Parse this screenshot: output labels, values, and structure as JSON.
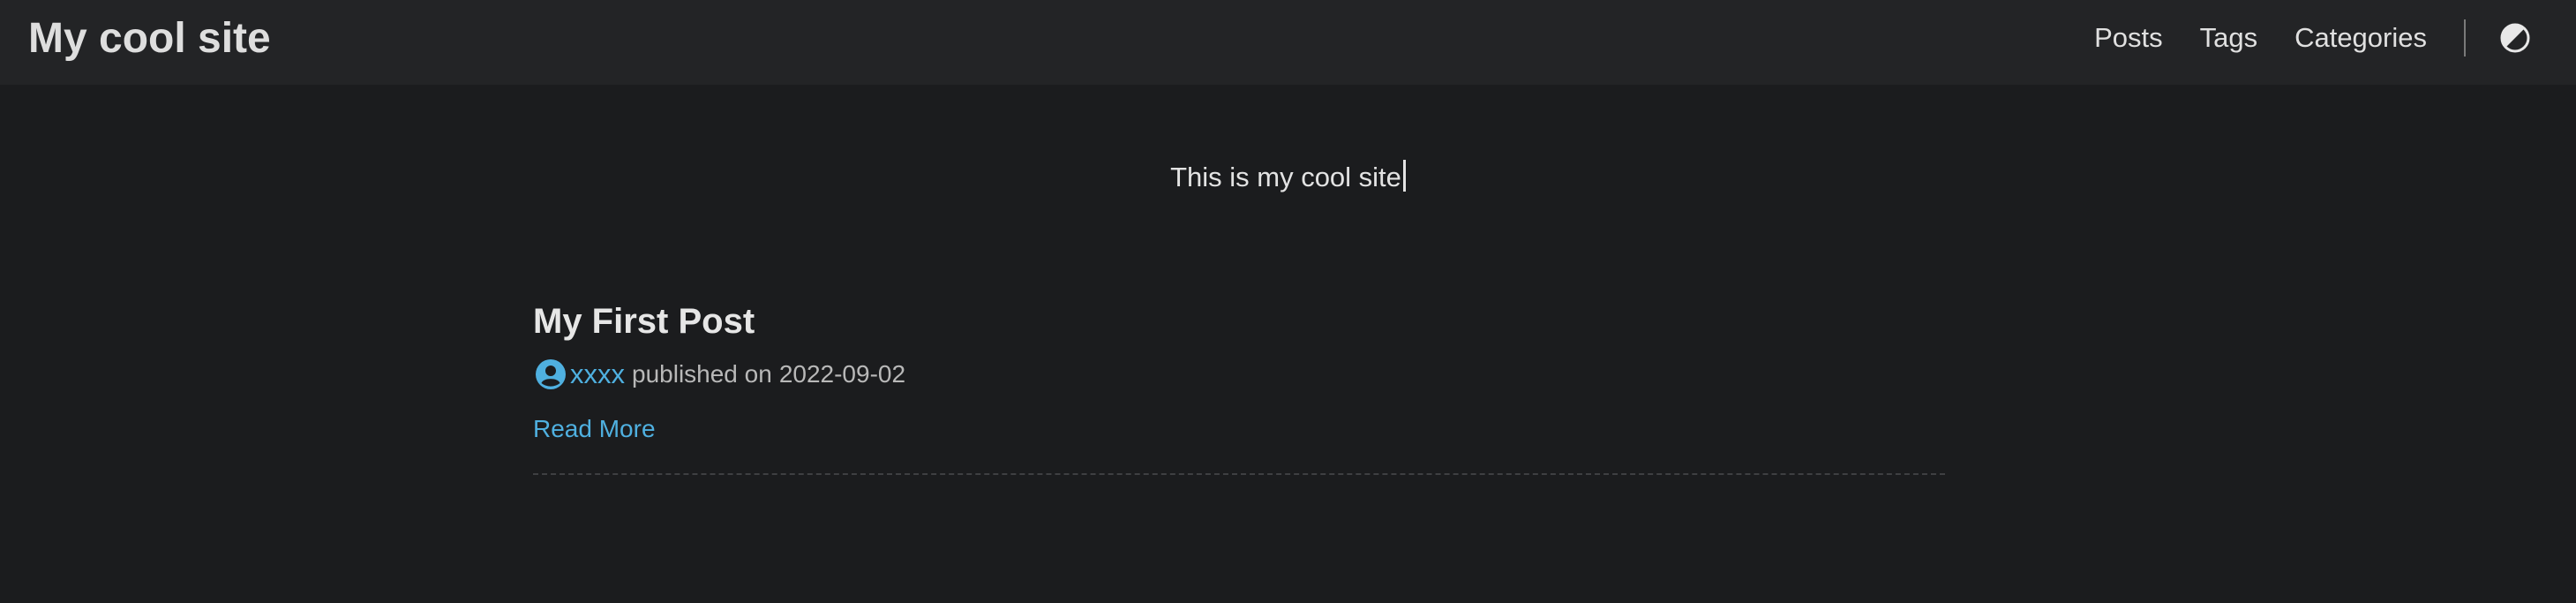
{
  "header": {
    "site_title": "My cool site",
    "nav": [
      "Posts",
      "Tags",
      "Categories"
    ],
    "theme_toggle_icon": "contrast-icon"
  },
  "main": {
    "tagline": "This is my cool site",
    "posts": [
      {
        "title": "My First Post",
        "author_icon": "user-circle-icon",
        "author": "xxxx",
        "published_text": "published on",
        "date": "2022-09-02",
        "read_more": "Read More"
      }
    ]
  },
  "colors": {
    "background": "#1b1c1e",
    "header_background": "#232426",
    "link_accent": "#4fb0e0",
    "text": "#dadadb"
  }
}
